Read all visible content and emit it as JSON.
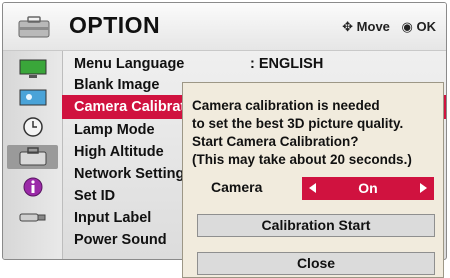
{
  "header": {
    "title": "OPTION",
    "icon": "option-briefcase-icon",
    "hint_move": "Move",
    "hint_ok": "OK"
  },
  "sidebar": {
    "icons": [
      "picture-monitor-icon",
      "screen-icon",
      "clock-icon",
      "option-briefcase-icon",
      "info-icon",
      "usb-icon"
    ],
    "active_index": 3
  },
  "menu": {
    "items": [
      {
        "label": "Menu Language",
        "value": ": ENGLISH"
      },
      {
        "label": "Blank Image",
        "value": ""
      },
      {
        "label": "Camera Calibrat",
        "value": ""
      },
      {
        "label": "Lamp Mode",
        "value": ""
      },
      {
        "label": "High Altitude",
        "value": ""
      },
      {
        "label": "Network Setting",
        "value": ""
      },
      {
        "label": "Set ID",
        "value": ""
      },
      {
        "label": "Input Label",
        "value": ""
      },
      {
        "label": "Power Sound",
        "value": ""
      }
    ],
    "selected_index": 2
  },
  "popup": {
    "message_lines": [
      "Camera calibration is needed",
      "to set the best 3D picture quality.",
      "Start Camera Calibration?",
      "(This may take about 20 seconds.)"
    ],
    "camera_label": "Camera",
    "camera_value": "On",
    "start_button": "Calibration Start",
    "close_button": "Close"
  },
  "colors": {
    "accent": "#d0123f",
    "popup_bg": "#f1ebdd",
    "button_bg": "#dbdbdb"
  }
}
